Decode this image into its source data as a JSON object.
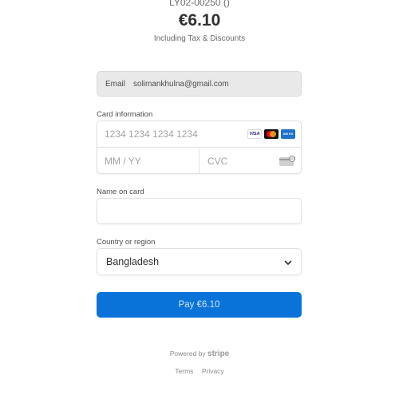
{
  "summary": {
    "order_id": "LY02-00250 ()",
    "amount": "€6.10",
    "note": "Including Tax & Discounts"
  },
  "email": {
    "label": "Email",
    "value": "solimankhulna@gmail.com"
  },
  "card": {
    "label": "Card information",
    "number_placeholder": "1234 1234 1234 1234",
    "expiry_placeholder": "MM / YY",
    "cvc_placeholder": "CVC",
    "brands": [
      "visa-icon",
      "mastercard-icon",
      "amex-icon"
    ],
    "visa_text": "VISA",
    "amex_text": "AM EX"
  },
  "name": {
    "label": "Name on card",
    "value": ""
  },
  "country": {
    "label": "Country or region",
    "selected": "Bangladesh"
  },
  "pay": {
    "label": "Pay €6.10",
    "color": "#0a73d9"
  },
  "footer": {
    "powered_by": "Powered by",
    "brand": "stripe",
    "terms": "Terms",
    "privacy": "Privacy"
  }
}
